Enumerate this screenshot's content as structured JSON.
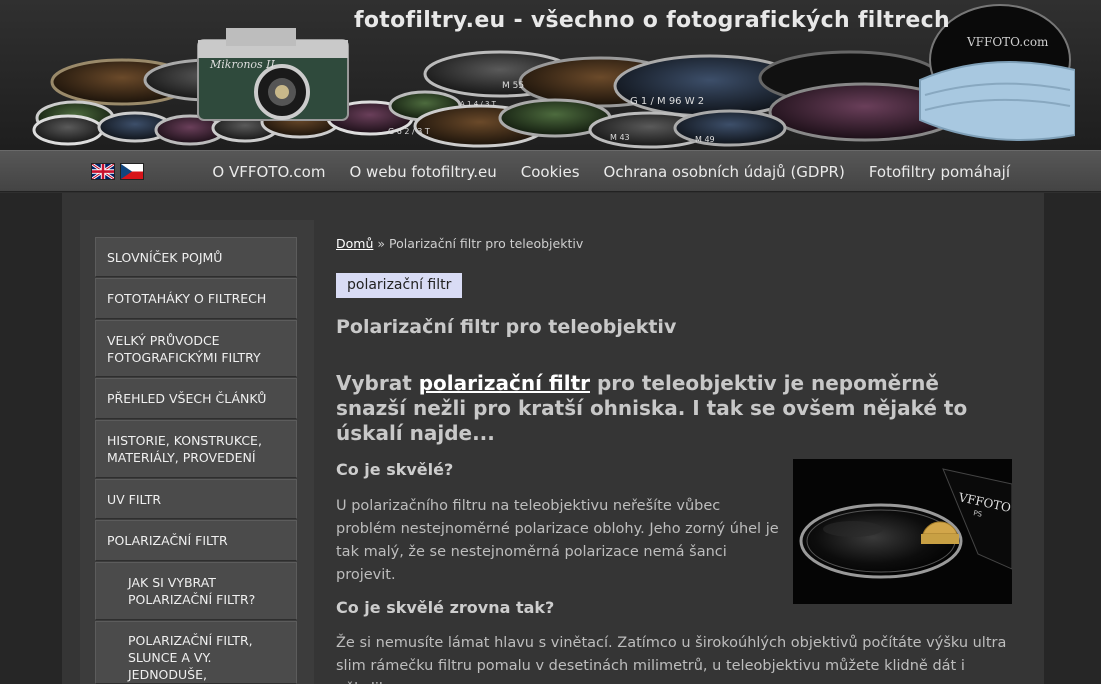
{
  "header": {
    "site_title": "fotofiltry.eu - všechno o fotografických filtrech",
    "camera_text": "Mikronos II",
    "box_brand": "VFFOTO.com",
    "filter_engravings": [
      "M 55",
      "G 1 / M 96 W 2",
      "M 43",
      "M 49",
      "G 6 2 / 3 T",
      "A 1 4 / 3 T"
    ]
  },
  "nav": {
    "languages": [
      "english-flag",
      "czech-flag"
    ],
    "links": [
      "O VFFOTO.com",
      "O webu fotofiltry.eu",
      "Cookies",
      "Ochrana osobních údajů (GDPR)",
      "Fotofiltry pomáhají"
    ]
  },
  "sidebar": {
    "items": [
      "SLOVNÍČEK POJMŮ",
      "FOTOTAHÁKY O FILTRECH",
      "VELKÝ PRŮVODCE FOTOGRAFICKÝMI FILTRY",
      "PŘEHLED VŠECH ČLÁNKŮ",
      "HISTORIE, KONSTRUKCE, MATERIÁLY, PROVEDENÍ",
      "UV FILTR",
      "POLARIZAČNÍ FILTR"
    ],
    "subitems": [
      "JAK SI VYBRAT POLARIZAČNÍ FILTR?",
      "POLARIZAČNÍ FILTR, SLUNCE A VY. JEDNODUŠE, SROZUMITELNĚ."
    ]
  },
  "content": {
    "breadcrumb_home": "Domů",
    "breadcrumb_sep": " » ",
    "breadcrumb_current": "Polarizační filtr pro teleobjektiv",
    "tag": "polarizační filtr",
    "title": "Polarizační filtr pro teleobjektiv",
    "lead_prefix": "Vybrat ",
    "lead_link": "polarizační filtr",
    "lead_suffix": " pro teleobjektiv je nepoměrně snazší nežli pro kratší ohniska. I tak se ovšem nějaké to úskalí najde...",
    "h1": "Co je skvělé?",
    "p1": "U polarizačního filtru na teleobjektivu neřešíte vůbec problém nestejnoměrné polarizace oblohy. Jeho zorný úhel je tak malý, že se nestejnoměrná polarizace nemá šanci projevit.",
    "h2": "Co je skvělé zrovna tak?",
    "p2": "Že si nemusíte lámat hlavu s vinětací. Zatímco u širokoúhlých objektivů počítáte výšku ultra slim rámečku filtru pomalu v desetinách milimetrů, u teleobjektivu můžete klidně dát i několik",
    "image_brand": "VFFOTO",
    "image_sub": "PS"
  }
}
